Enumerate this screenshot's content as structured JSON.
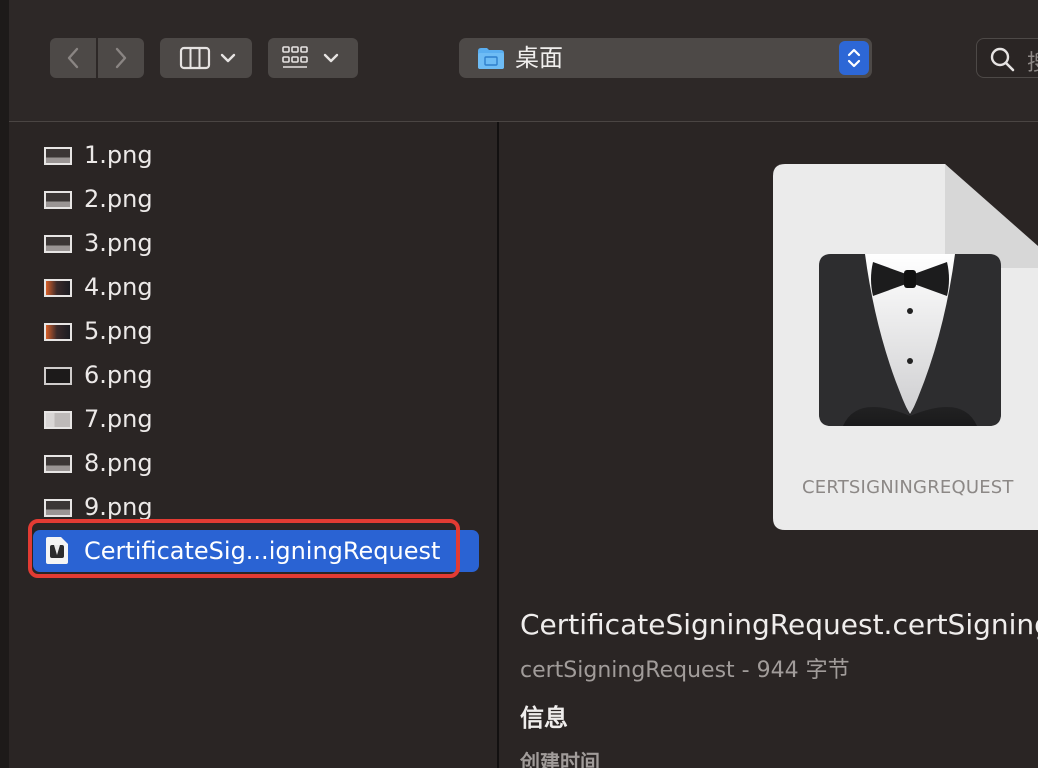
{
  "toolbar": {
    "back_icon": "chevron-left-icon",
    "forward_icon": "chevron-right-icon",
    "view_icon": "column-view-icon",
    "group_icon": "grid-group-icon",
    "location": "桌面",
    "location_icon": "desktop-folder-icon",
    "search_placeholder": "搜"
  },
  "files": [
    {
      "name": "1.png",
      "thumb": "plain"
    },
    {
      "name": "2.png",
      "thumb": "plain"
    },
    {
      "name": "3.png",
      "thumb": "plain"
    },
    {
      "name": "4.png",
      "thumb": "image"
    },
    {
      "name": "5.png",
      "thumb": "image"
    },
    {
      "name": "6.png",
      "thumb": "dark"
    },
    {
      "name": "7.png",
      "thumb": "window"
    },
    {
      "name": "8.png",
      "thumb": "plain"
    },
    {
      "name": "9.png",
      "thumb": "plain"
    },
    {
      "name": "CertificateSig...igningRequest",
      "thumb": "cert",
      "selected": true
    }
  ],
  "preview": {
    "doc_label": "CERTSIGNINGREQUEST",
    "title": "CertificateSigningRequest.certSigningRequest",
    "subtitle": "certSigningRequest - 944 字节",
    "info_heading": "信息",
    "created_label": "创建时间"
  },
  "colors": {
    "selection": "#2a63d3",
    "highlight_border": "#e23b33",
    "folder": "#5aaef0"
  }
}
